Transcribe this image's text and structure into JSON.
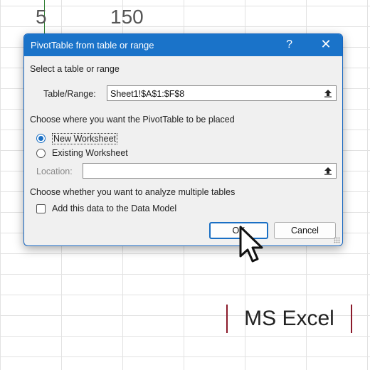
{
  "sheet": {
    "visible_cells": [
      "5",
      "150"
    ]
  },
  "dialog": {
    "title": "PivotTable from table or range",
    "help_glyph": "?",
    "close_glyph": "✕",
    "section1_label": "Select a table or range",
    "table_range_label": "Table/Range:",
    "table_range_value": "Sheet1!$A$1:$F$8",
    "section2_label": "Choose where you want the PivotTable to be placed",
    "radio_new": "New Worksheet",
    "radio_existing": "Existing Worksheet",
    "location_label": "Location:",
    "location_value": "",
    "section3_label": "Choose whether you want to analyze multiple tables",
    "data_model_label": "Add this data to the Data Model",
    "ok_label": "OK",
    "cancel_label": "Cancel"
  },
  "brand": {
    "text": "MS Excel",
    "accent_color": "#8b1a2a"
  },
  "colors": {
    "titlebar": "#1a73c9",
    "dialog_bg": "#f0f0f0",
    "radio_selected": "#1a6fc4"
  },
  "state": {
    "selected_placement": "New Worksheet",
    "data_model_checked": false
  }
}
